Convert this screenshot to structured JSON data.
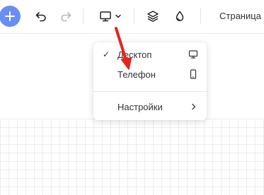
{
  "toolbar": {
    "add_button": "+",
    "page_label": "Страница",
    "icons": [
      "plus-icon",
      "undo-icon",
      "redo-icon",
      "desktop-icon",
      "chevron-down-icon",
      "layers-icon",
      "drop-icon"
    ]
  },
  "device_menu": {
    "items": [
      {
        "label": "Десктоп",
        "checked": true,
        "icon": "desktop-icon"
      },
      {
        "label": "Телефон",
        "checked": false,
        "icon": "phone-icon"
      }
    ],
    "settings": {
      "label": "Настройки",
      "icon": "chevron-right-icon"
    }
  },
  "colors": {
    "accent": "#6a8ef3",
    "annotation_arrow": "#e8231e"
  }
}
